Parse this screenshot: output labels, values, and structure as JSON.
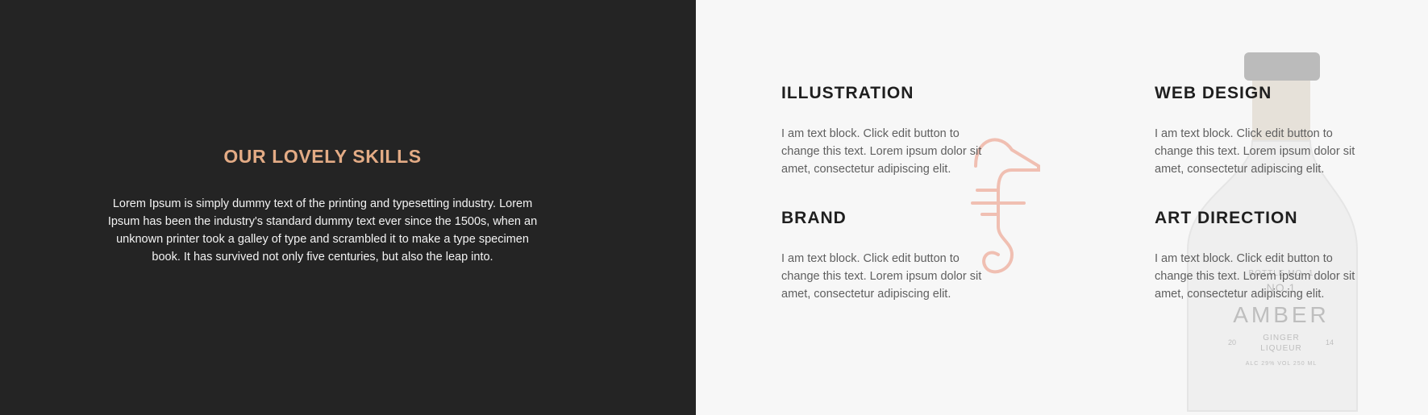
{
  "intro": {
    "heading": "OUR LOVELY SKILLS",
    "body": "Lorem Ipsum is simply dummy text of the printing and typesetting industry. Lorem Ipsum has been the industry's standard dummy text ever since the 1500s, when an unknown printer took a galley of type and scrambled it to make a type specimen book. It has survived not only five centuries, but also the leap into."
  },
  "skills": [
    {
      "title": "ILLUSTRATION",
      "text": "I am text block. Click edit button to change this text. Lorem ipsum dolor sit amet, consectetur adipiscing elit."
    },
    {
      "title": "WEB DESIGN",
      "text": "I am text block. Click edit button to change this text. Lorem ipsum dolor sit amet, consectetur adipiscing elit."
    },
    {
      "title": "BRAND",
      "text": "I am text block. Click edit button to change this text. Lorem ipsum dolor sit amet, consectetur adipiscing elit."
    },
    {
      "title": "ART DIRECTION",
      "text": "I am text block. Click edit button to change this text. Lorem ipsum dolor sit amet, consectetur adipiscing elit."
    }
  ],
  "bottle": {
    "arc_label": "BOTTLE MO. 1",
    "number": "NO.1",
    "brand": "AMBER",
    "year_left": "20",
    "year_right": "14",
    "sub1": "GINGER",
    "sub2": "LIQUEUR",
    "abv": "ALC 29% VOL 250 ML"
  },
  "colors": {
    "dark_panel": "#242424",
    "accent": "#e3ab85",
    "light_panel": "#f7f7f7",
    "heading_text": "#1f1f1f",
    "body_text": "#5f5f5f",
    "seahorse": "#f0bfb2"
  },
  "icons": [
    "seahorse-icon"
  ]
}
